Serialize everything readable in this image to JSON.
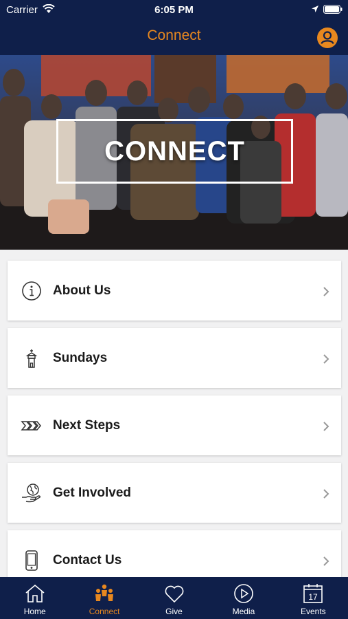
{
  "status_bar": {
    "carrier": "Carrier",
    "time": "6:05 PM"
  },
  "header": {
    "title": "Connect"
  },
  "hero": {
    "text": "CONNECT"
  },
  "menu": [
    {
      "label": "About Us",
      "icon": "info-icon"
    },
    {
      "label": "Sundays",
      "icon": "church-icon"
    },
    {
      "label": "Next Steps",
      "icon": "steps-arrows-icon"
    },
    {
      "label": "Get Involved",
      "icon": "globe-hand-icon"
    },
    {
      "label": "Contact Us",
      "icon": "phone-icon"
    }
  ],
  "tabs": [
    {
      "label": "Home",
      "icon": "home-icon"
    },
    {
      "label": "Connect",
      "icon": "people-icon",
      "active": true
    },
    {
      "label": "Give",
      "icon": "heart-icon"
    },
    {
      "label": "Media",
      "icon": "play-icon"
    },
    {
      "label": "Events",
      "icon": "calendar-icon",
      "calendar_day": "17"
    }
  ],
  "colors": {
    "navy": "#0f1f4a",
    "accent": "#e8881f"
  }
}
